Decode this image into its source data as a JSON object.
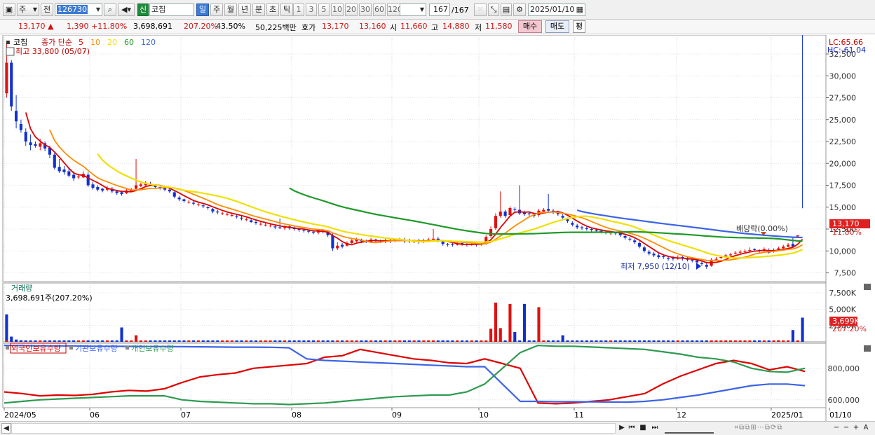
{
  "toolbar": {
    "period_type": "주",
    "prev_label": "전",
    "code": "126730",
    "market_badge": "신",
    "name": "코칩",
    "periods": [
      "일",
      "주",
      "월",
      "년",
      "분",
      "초",
      "틱"
    ],
    "period_selected": "일",
    "intervals": [
      "1",
      "3",
      "5",
      "10",
      "20",
      "30",
      "60",
      "120"
    ],
    "count": "167",
    "total": "/167",
    "date": "2025/01/10"
  },
  "quote": {
    "price": "13,170",
    "arrow": "▲",
    "change": "1,390",
    "change_pct": "+11.80%",
    "volume": "3,698,691",
    "volume_ratio": "207.20%",
    "turnover": "43.50%",
    "amount": "50,225백만",
    "hoga_label": "호가",
    "ask": "13,170",
    "bid": "13,160",
    "open_label": "시",
    "open": "11,660",
    "high_label": "고",
    "high": "14,880",
    "low_label": "저",
    "low": "11,580",
    "buy_label": "매수",
    "sell_label": "매도",
    "eval_label": "평"
  },
  "price_panel": {
    "stock_label": "코칩",
    "ma_title": "종가 단순",
    "ma_periods": [
      "5",
      "10",
      "20",
      "60",
      "120"
    ],
    "ma_colors": [
      "#e00000",
      "#ff8c00",
      "#f0e000",
      "#1e9a28",
      "#3c64e6"
    ],
    "high_note": "최고 33,800 (05/07)",
    "low_note": "최저 7,950 (12/10)",
    "dividend_note": "배당락(0.00%)",
    "lc": "LC:65.66",
    "hc": "HC:-61.04",
    "current_tag": "13,170",
    "current_pct": "11.80%"
  },
  "volume_panel": {
    "title": "거래량",
    "value_note": "3,698,691주(207.20%)",
    "current_tag": "3,699K",
    "current_pct": "207.20%"
  },
  "holding_panel": {
    "legend": [
      "외국인보유수량",
      "기관보유수량",
      "개인보유수량"
    ],
    "colors": [
      "#e00000",
      "#3c64e6",
      "#2e9a50"
    ]
  },
  "x_axis": {
    "labels": [
      "2024/05",
      "06",
      "07",
      "08",
      "09",
      "10",
      "11",
      "12",
      "2025/01",
      "01/10"
    ]
  },
  "chart_data": [
    {
      "type": "candlestick",
      "name": "price",
      "ylim": [
        6500,
        34500
      ],
      "yticks": [
        "7,500",
        "10,000",
        "12,500",
        "15,000",
        "17,500",
        "20,000",
        "22,500",
        "25,000",
        "27,500",
        "30,000",
        "32,500"
      ],
      "n": 167,
      "close": [
        31500,
        26500,
        24800,
        23800,
        22500,
        22100,
        22000,
        22300,
        21700,
        21000,
        19500,
        19100,
        19000,
        18600,
        18300,
        18500,
        18800,
        17500,
        17200,
        17000,
        16900,
        17200,
        16800,
        16600,
        16500,
        16900,
        17000,
        17500,
        17600,
        17800,
        17500,
        17300,
        17200,
        17000,
        16800,
        16200,
        15900,
        15700,
        15600,
        15400,
        15300,
        15100,
        14900,
        14500,
        14400,
        14300,
        14200,
        14100,
        13900,
        13700,
        13600,
        13300,
        13200,
        13100,
        13000,
        12900,
        12700,
        12600,
        12700,
        12600,
        12500,
        12400,
        12300,
        12200,
        12100,
        12400,
        12200,
        11800,
        10300,
        10600,
        10500,
        10900,
        11200,
        11300,
        11100,
        11000,
        11300,
        11200,
        11100,
        11200,
        11100,
        11300,
        11300,
        11100,
        11100,
        11100,
        11000,
        11200,
        11300,
        11400,
        11200,
        10800,
        10700,
        10700,
        10800,
        10800,
        10700,
        10800,
        10700,
        10800,
        11600,
        12500,
        14000,
        14500,
        14000,
        14900,
        14700,
        14300,
        14200,
        14200,
        14000,
        14600,
        14700,
        14600,
        14400,
        14200,
        13800,
        13400,
        13000,
        12700,
        12600,
        12500,
        12400,
        12300,
        12200,
        12100,
        12100,
        12000,
        11800,
        11500,
        11300,
        11000,
        10500,
        10000,
        9700,
        9500,
        9300,
        9300,
        9100,
        9100,
        9200,
        9200,
        9000,
        8900,
        8700,
        8500,
        8200,
        9000,
        9100,
        9300,
        9500,
        9600,
        9800,
        9900,
        10000,
        10100,
        10100,
        10000,
        10200,
        9800,
        10100,
        10300,
        10500,
        10700,
        10500,
        11780,
        13170
      ],
      "open": [
        28000,
        31500,
        26000,
        24500,
        23600,
        22400,
        22200,
        21900,
        22300,
        21800,
        21000,
        19600,
        19300,
        19100,
        18700,
        18400,
        18400,
        18700,
        17600,
        17300,
        17100,
        17000,
        17100,
        16800,
        16700,
        16600,
        16800,
        17100,
        17400,
        17500,
        17700,
        17500,
        17300,
        17200,
        17000,
        16700,
        16100,
        15900,
        15600,
        15500,
        15300,
        15200,
        15000,
        14800,
        14500,
        14300,
        14200,
        14100,
        14000,
        13800,
        13600,
        13500,
        13300,
        13100,
        13000,
        12900,
        12800,
        12700,
        12600,
        12800,
        12600,
        12500,
        12400,
        12300,
        12200,
        12100,
        12300,
        12200,
        11800,
        10300,
        10700,
        10600,
        10900,
        11100,
        11300,
        11100,
        11000,
        11300,
        11200,
        11000,
        11200,
        11200,
        11200,
        11300,
        11200,
        11100,
        11200,
        11000,
        11200,
        11300,
        11400,
        11100,
        10800,
        10800,
        10700,
        10900,
        10800,
        10700,
        10800,
        10700,
        10900,
        11700,
        12600,
        14000,
        14500,
        14100,
        14800,
        14700,
        14400,
        14300,
        14100,
        14100,
        14500,
        14800,
        14600,
        14400,
        14000,
        13600,
        13200,
        12900,
        12700,
        12600,
        12500,
        12400,
        12300,
        12200,
        12000,
        12100,
        12000,
        11700,
        11400,
        11200,
        10900,
        10400,
        9900,
        9700,
        9500,
        9400,
        9200,
        9200,
        9100,
        9300,
        9200,
        9000,
        8900,
        8600,
        8400,
        8300,
        9000,
        9200,
        9300,
        9500,
        9700,
        9800,
        9900,
        10100,
        10200,
        10100,
        10100,
        10100,
        9900,
        10100,
        10300,
        10500,
        10800,
        11660
      ],
      "high": [
        33800,
        31800,
        27800,
        25000,
        24000,
        23300,
        22500,
        22800,
        22500,
        22000,
        21200,
        20500,
        19700,
        19400,
        19100,
        18800,
        19100,
        19000,
        17900,
        17500,
        17200,
        17400,
        17300,
        17000,
        16900,
        17100,
        17200,
        20500,
        18000,
        18000,
        17900,
        17600,
        17500,
        17300,
        17100,
        16800,
        16300,
        16000,
        15800,
        15700,
        15500,
        15300,
        15100,
        14900,
        14700,
        14500,
        14400,
        14300,
        14200,
        14000,
        13800,
        13700,
        13600,
        13400,
        13300,
        13100,
        13000,
        13700,
        12900,
        12900,
        12800,
        12600,
        12500,
        12400,
        12300,
        12500,
        12500,
        12300,
        12000,
        11000,
        10900,
        11100,
        11400,
        11500,
        11400,
        11300,
        11500,
        11400,
        11300,
        11400,
        11400,
        11400,
        11500,
        11500,
        11400,
        11300,
        11400,
        11400,
        11500,
        12500,
        11600,
        11200,
        10900,
        10900,
        11000,
        11000,
        10900,
        11000,
        10900,
        11000,
        11800,
        12800,
        14300,
        16800,
        14700,
        15100,
        15000,
        17500,
        14600,
        14500,
        14400,
        14800,
        14900,
        16500,
        14800,
        14600,
        14200,
        13800,
        13400,
        13100,
        12900,
        12800,
        12700,
        12600,
        12400,
        12300,
        12300,
        12200,
        12100,
        11900,
        11600,
        11400,
        11100,
        10600,
        10100,
        9900,
        9700,
        9600,
        9400,
        9400,
        9500,
        9400,
        9400,
        9200,
        9100,
        8800,
        8600,
        9200,
        9300,
        9500,
        9700,
        9800,
        10000,
        10100,
        10200,
        10400,
        10300,
        10200,
        10400,
        10300,
        10300,
        10500,
        10700,
        10900,
        11500,
        11800,
        14880
      ],
      "low": [
        27500,
        26000,
        24000,
        23500,
        22000,
        21500,
        21800,
        21500,
        21400,
        20600,
        19300,
        18900,
        18700,
        18400,
        18000,
        18200,
        18300,
        17300,
        17000,
        16800,
        16700,
        16800,
        16600,
        16400,
        16300,
        16500,
        16700,
        16900,
        17300,
        17400,
        17400,
        17100,
        17000,
        16800,
        16600,
        16000,
        15700,
        15500,
        15400,
        15200,
        15100,
        14900,
        14700,
        14300,
        14200,
        14100,
        14000,
        13900,
        13700,
        13500,
        13400,
        13200,
        13000,
        12900,
        12800,
        12700,
        12500,
        12500,
        12400,
        12400,
        12300,
        12200,
        12100,
        12000,
        11900,
        11900,
        12000,
        11600,
        10000,
        10100,
        10300,
        10500,
        10800,
        11000,
        10900,
        10900,
        10900,
        11000,
        10900,
        10900,
        10900,
        11000,
        11100,
        10900,
        10900,
        10900,
        10800,
        10900,
        11000,
        11100,
        11000,
        10600,
        10500,
        10500,
        10600,
        10600,
        10500,
        10600,
        10500,
        10600,
        10700,
        11500,
        12400,
        13800,
        13800,
        13900,
        14500,
        14100,
        14000,
        14000,
        13800,
        13900,
        14400,
        14400,
        14200,
        14000,
        13600,
        13200,
        12800,
        12500,
        12400,
        12300,
        12200,
        12100,
        12000,
        11900,
        11800,
        11800,
        11600,
        11300,
        11100,
        10800,
        10300,
        9800,
        9500,
        9300,
        9100,
        9100,
        8900,
        8900,
        9000,
        8900,
        8800,
        8700,
        8500,
        8300,
        7950,
        8200,
        8900,
        9100,
        9300,
        9400,
        9600,
        9700,
        9800,
        9900,
        9900,
        9800,
        9900,
        9700,
        9800,
        10000,
        10200,
        10400,
        10400,
        11580
      ]
    },
    {
      "type": "bar",
      "name": "volume",
      "ylim": [
        0,
        9000
      ],
      "yticks": [
        "2,500K",
        "5,000K",
        "7,500K"
      ],
      "bars": [
        [
          0,
          4200
        ],
        [
          1,
          800
        ],
        [
          2,
          350
        ],
        [
          3,
          250
        ],
        [
          4,
          200
        ],
        [
          14,
          150
        ],
        [
          24,
          2200
        ],
        [
          27,
          1000
        ],
        [
          75,
          200
        ],
        [
          91,
          150
        ],
        [
          101,
          2000
        ],
        [
          102,
          6000
        ],
        [
          103,
          2100
        ],
        [
          105,
          5800
        ],
        [
          106,
          1500
        ],
        [
          108,
          5800
        ],
        [
          111,
          5300
        ],
        [
          116,
          1000
        ],
        [
          147,
          200
        ],
        [
          161,
          250
        ],
        [
          164,
          1800
        ],
        [
          166,
          3699
        ]
      ]
    },
    {
      "type": "line",
      "name": "holdings",
      "ylim": [
        550000,
        950000
      ],
      "yticks": [
        "600,000",
        "800,000"
      ],
      "series": [
        {
          "name": "외국인보유수량",
          "values": [
            650000,
            640000,
            625000,
            630000,
            628000,
            635000,
            650000,
            660000,
            655000,
            670000,
            710000,
            745000,
            760000,
            770000,
            800000,
            810000,
            820000,
            830000,
            870000,
            880000,
            920000,
            900000,
            880000,
            860000,
            850000,
            835000,
            830000,
            860000,
            830000,
            800000,
            580000,
            575000,
            580000,
            590000,
            600000,
            620000,
            640000,
            700000,
            750000,
            790000,
            830000,
            850000,
            830000,
            790000,
            810000,
            780000
          ]
        },
        {
          "name": "기관보유수량",
          "values": [
            945000,
            944000,
            943000,
            942000,
            942000,
            940000,
            940000,
            939000,
            938000,
            938000,
            937000,
            936000,
            935000,
            934000,
            934000,
            933000,
            930000,
            860000,
            850000,
            845000,
            840000,
            835000,
            830000,
            825000,
            820000,
            815000,
            810000,
            810000,
            700000,
            590000,
            590000,
            588000,
            588000,
            587000,
            586000,
            585000,
            590000,
            600000,
            615000,
            630000,
            650000,
            670000,
            690000,
            700000,
            700000,
            690000
          ]
        },
        {
          "name": "개인보유수량",
          "values": [
            580000,
            590000,
            600000,
            605000,
            610000,
            615000,
            620000,
            625000,
            625000,
            625000,
            600000,
            590000,
            585000,
            580000,
            575000,
            575000,
            570000,
            575000,
            580000,
            590000,
            600000,
            610000,
            620000,
            625000,
            630000,
            630000,
            650000,
            700000,
            800000,
            900000,
            945000,
            940000,
            940000,
            935000,
            930000,
            925000,
            920000,
            905000,
            890000,
            870000,
            860000,
            840000,
            800000,
            780000,
            775000,
            800000
          ]
        }
      ]
    }
  ]
}
